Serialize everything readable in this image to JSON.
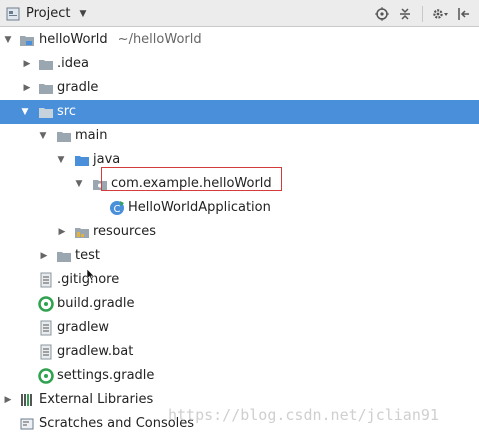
{
  "toolbar": {
    "title": "Project",
    "icons": [
      "project-view-icon",
      "caret-down-icon",
      "locate-icon",
      "collapse-all-icon",
      "gear-icon",
      "hide-icon"
    ]
  },
  "tree": {
    "rows": [
      {
        "label": "helloWorld",
        "hint": "~/helloWorld",
        "expanded": true
      },
      {
        "label": ".idea",
        "expanded": false
      },
      {
        "label": "gradle",
        "expanded": false
      },
      {
        "label": "src",
        "expanded": true,
        "selected": true
      },
      {
        "label": "main",
        "expanded": true
      },
      {
        "label": "java",
        "expanded": true
      },
      {
        "label": "com.example.helloWorld",
        "expanded": true
      },
      {
        "label": "HelloWorldApplication",
        "highlighted": true
      },
      {
        "label": "resources",
        "expanded": false
      },
      {
        "label": "test",
        "expanded": false
      },
      {
        "label": ".gitignore"
      },
      {
        "label": "build.gradle"
      },
      {
        "label": "gradlew"
      },
      {
        "label": "gradlew.bat"
      },
      {
        "label": "settings.gradle"
      },
      {
        "label": "External Libraries",
        "expanded": false
      },
      {
        "label": "Scratches and Consoles"
      }
    ]
  },
  "watermark": "https://blog.csdn.net/jclian91",
  "colors": {
    "selection": "#4a8fd9",
    "highlight_border": "#d63b3b",
    "folder": "#9aa7b0",
    "source_folder": "#4a8fd9",
    "gradle": "#2fa24f"
  }
}
